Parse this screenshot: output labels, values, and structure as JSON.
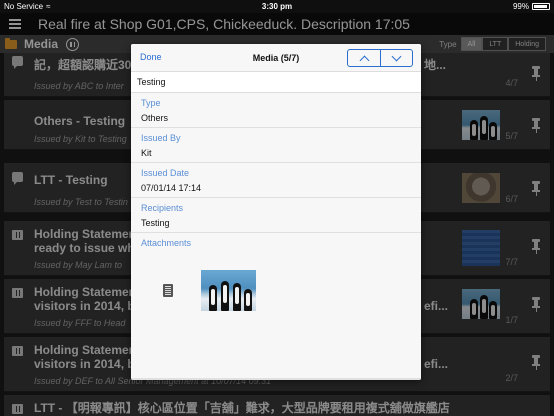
{
  "status_bar": {
    "carrier": "No Service",
    "time": "3:30 pm",
    "battery": "99%"
  },
  "title_bar": {
    "title": "Real fire at Shop G01,CPS, Chickeeduck. Description 17:05"
  },
  "sub_bar": {
    "section_label": "Media",
    "filter_label": "Type",
    "filters": [
      "All",
      "LTT",
      "Holding"
    ],
    "active_filter": "All"
  },
  "list": [
    {
      "title": "記，超額認購近30",
      "title_right": "地...",
      "issued": "Issued by ABC to Inter",
      "count": "4/7",
      "icon": "bubble-icon",
      "thumb": ""
    },
    {
      "title": "Others - Testing",
      "title_right": "",
      "issued": "Issued by Kit to Testing",
      "count": "5/7",
      "icon": "",
      "thumb": "penguin"
    },
    {
      "title": "LTT - Testing",
      "title_right": "",
      "issued": "Issued by Test to Testin",
      "count": "6/7",
      "icon": "bubble-icon",
      "thumb": "koala"
    },
    {
      "title": "Holding Statemen",
      "title2": "ready to issue whe",
      "issued": "Issued by May Lam to",
      "count": "7/7",
      "icon": "grid-icon",
      "thumb": "blue"
    },
    {
      "title": "Holding Statemen",
      "title_right": "efi...",
      "title2": "visitors in 2014, b",
      "issued": "Issued by FFF to Head",
      "count": "1/7",
      "icon": "grid-icon",
      "thumb": "penguin"
    },
    {
      "title": "Holding Statemen",
      "title_right": "efi...",
      "title2": "visitors in 2014, b",
      "issued": "Issued by DEF to All Senior Management at 10/07/14 09:31",
      "count": "2/7",
      "icon": "grid-icon",
      "thumb": ""
    },
    {
      "title": "LTT - 【明報專訊】核心區位置「吉舖」難求，大型品牌要租用複式舖做旗艦店",
      "issued": "",
      "count": "",
      "icon": "grid-icon",
      "thumb": ""
    }
  ],
  "modal": {
    "done_label": "Done",
    "title": "Media (5/7)",
    "subject": "Testing",
    "fields": [
      {
        "label": "Type",
        "value": "Others"
      },
      {
        "label": "Issued By",
        "value": "Kit"
      },
      {
        "label": "Issued Date",
        "value": "07/01/14 17:14"
      },
      {
        "label": "Recipients",
        "value": "Testing"
      }
    ],
    "attachments_label": "Attachments"
  },
  "colors": {
    "accent": "#2a6ed0",
    "label_blue": "#5b8fd6",
    "folder": "#f0a030"
  }
}
